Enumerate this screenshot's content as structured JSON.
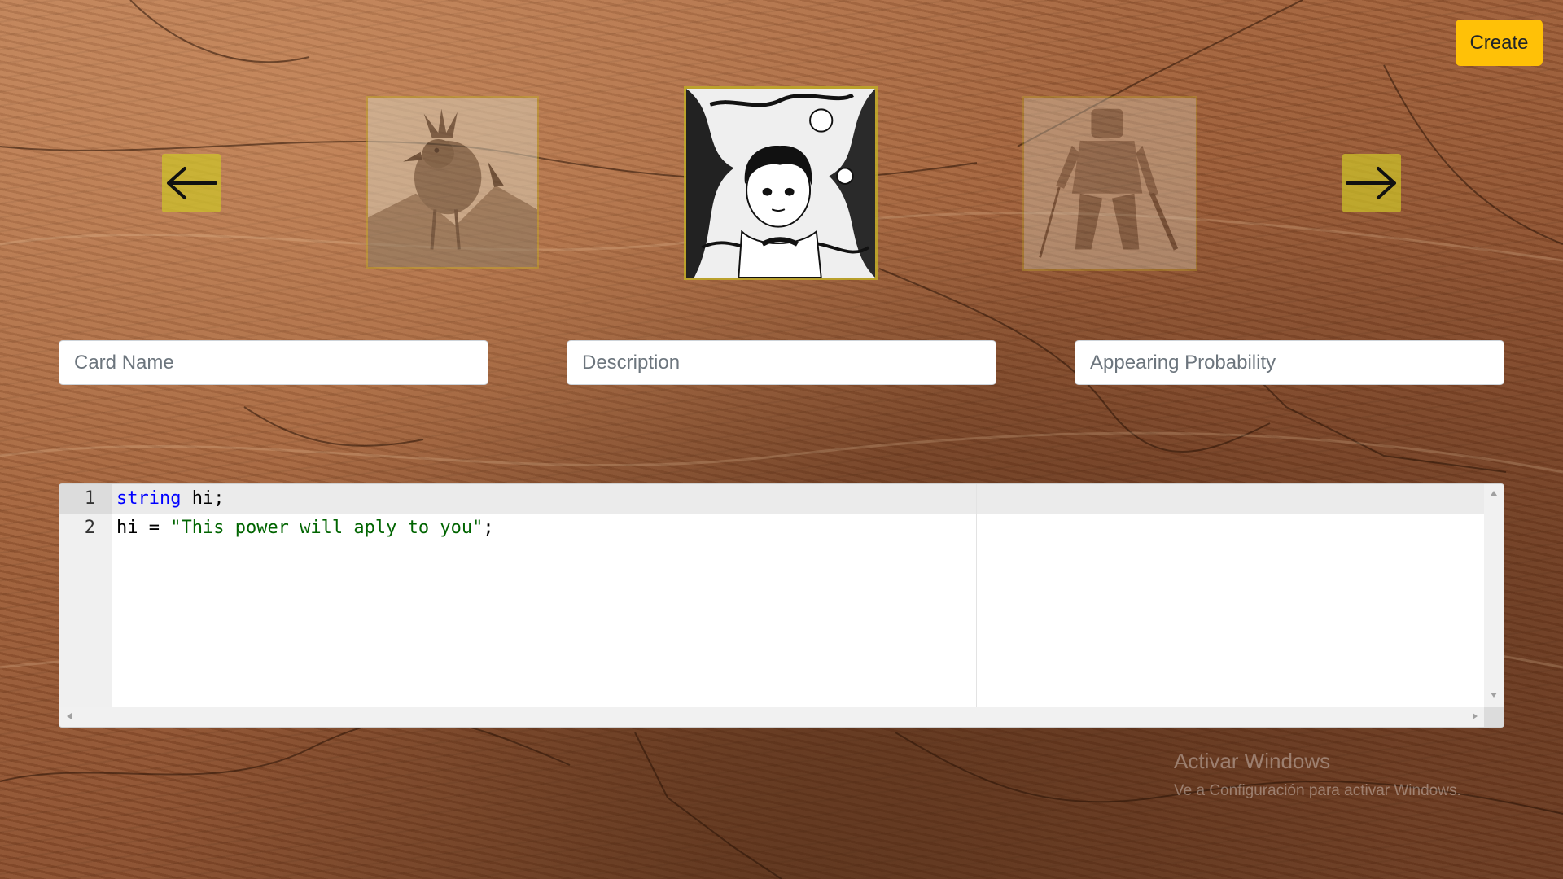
{
  "header": {
    "create_label": "Create"
  },
  "carousel": {
    "prev_icon": "arrow-left-icon",
    "next_icon": "arrow-right-icon",
    "cards": [
      {
        "name": "bird-creature-card",
        "state": "previous"
      },
      {
        "name": "manga-hero-card",
        "state": "selected"
      },
      {
        "name": "armored-knight-card",
        "state": "next"
      }
    ]
  },
  "form": {
    "card_name_placeholder": "Card Name",
    "description_placeholder": "Description",
    "probability_placeholder": "Appearing Probability"
  },
  "editor": {
    "line_numbers": [
      "1",
      "2"
    ],
    "line1": {
      "keyword": "string",
      "rest": " hi;"
    },
    "line2": {
      "prefix": "hi = ",
      "string_literal": "\"This power will aply to you\"",
      "suffix": ";"
    }
  },
  "watermark": {
    "title": "Activar Windows",
    "subtitle": "Ve a Configuración para activar Windows."
  },
  "colors": {
    "create_button": "#ffc107",
    "arrow_button": "#cdc328",
    "keyword": "#0000ff",
    "string": "#006400"
  }
}
